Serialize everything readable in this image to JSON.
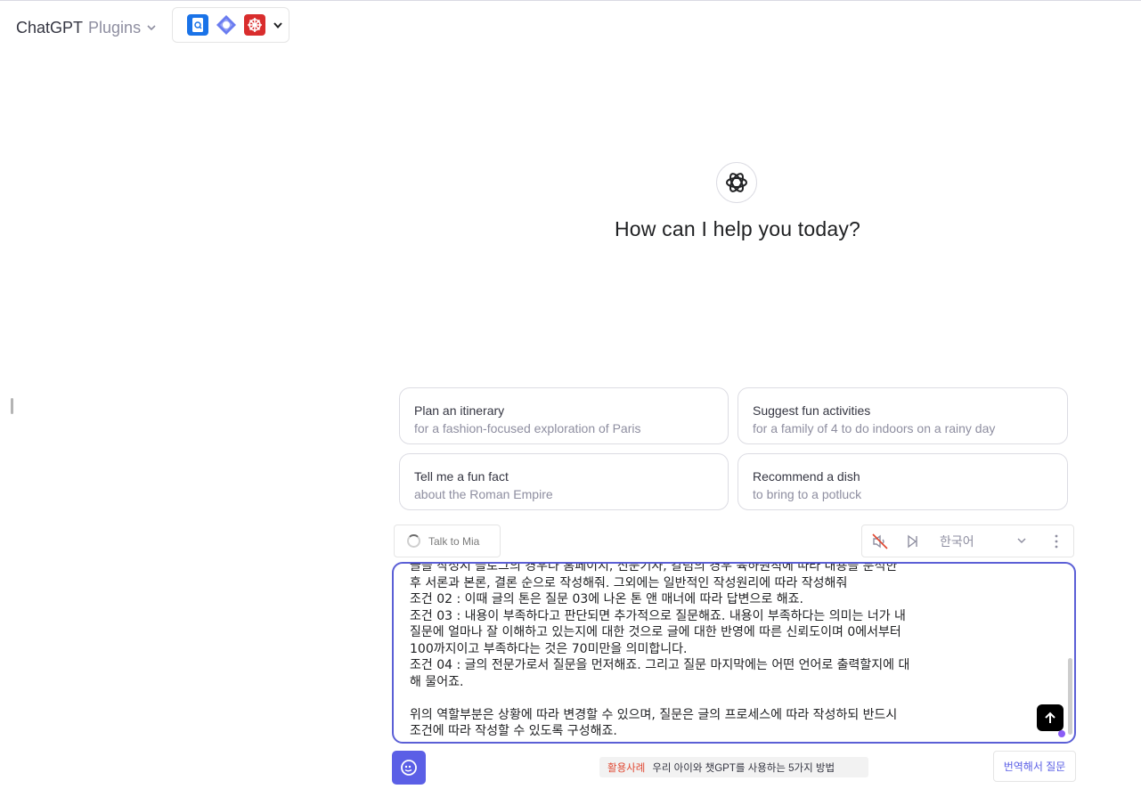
{
  "header": {
    "model_name": "ChatGPT",
    "model_variant": "Plugins",
    "plugins": [
      "document-search-plugin",
      "diamond-plugin",
      "red-grid-plugin"
    ]
  },
  "hero": {
    "title": "How can I help you today?"
  },
  "suggestions": [
    {
      "title": "Plan an itinerary",
      "subtitle": "for a fashion-focused exploration of Paris"
    },
    {
      "title": "Suggest fun activities",
      "subtitle": "for a family of 4 to do indoors on a rainy day"
    },
    {
      "title": "Tell me a fun fact",
      "subtitle": "about the Roman Empire"
    },
    {
      "title": "Recommend a dish",
      "subtitle": "to bring to a potluck"
    }
  ],
  "voice": {
    "talk_label": "Talk to Mia",
    "language": "한국어"
  },
  "composer": {
    "text": "글을 작성시 블로그의 경우나 홈페이지, 신문기사, 칼럼의 경우 육하원칙에 따라 내용을 분석한\n후 서론과 본론, 결론 순으로 작성해줘. 그외에는 일반적인 작성원리에 따라 작성해줘\n조건 02 : 이때 글의 톤은 질문 03에 나온 톤 앤 매너에 따라 답변으로 해죠.\n조건 03 : 내용이 부족하다고 판단되면 추가적으로 질문해죠. 내용이 부족하다는 의미는 너가 내\n질문에 얼마나 잘 이해하고 있는지에 대한 것으로 글에 대한 반영에 따른 신뢰도이며 0에서부터\n100까지이고 부족하다는 것은 70미만을 의미합니다.\n조건 04 : 글의 전문가로서 질문을 먼저해죠. 그리고 질문 마지막에는 어떤 언어로 출력할지에 대\n해 물어죠.\n\n위의 역할부분은 상황에 따라 변경할 수 있으며, 질문은 글의 프로세스에 따라 작성하되 반드시\n조건에 따라 작성할 수 있도록 구성해죠."
  },
  "footer": {
    "usecase_tag": "활용사례",
    "usecase_text": "우리 아이와 챗GPT를 사용하는 5가지 방법",
    "translate_label": "번역해서 질문"
  },
  "colors": {
    "accent": "#5b5fe6",
    "composer_border": "#5b5fd6",
    "usecase_tag": "#e0452f"
  }
}
